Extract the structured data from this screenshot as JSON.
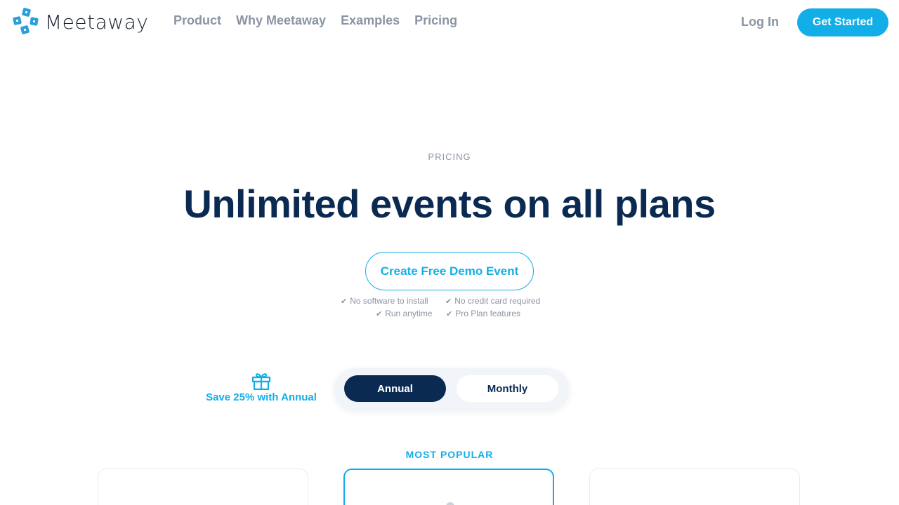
{
  "brand": {
    "name": "Meetaway"
  },
  "nav": {
    "links": [
      "Product",
      "Why Meetaway",
      "Examples",
      "Pricing"
    ],
    "login_label": "Log In",
    "cta_label": "Get Started"
  },
  "hero": {
    "eyebrow": "PRICING",
    "title": "Unlimited events on all plans",
    "demo_button": "Create Free Demo Event",
    "features": [
      "No software to install",
      "No credit card required",
      "Run anytime",
      "Pro Plan features"
    ]
  },
  "billing": {
    "save_text": "Save 25% with Annual",
    "options": [
      "Annual",
      "Monthly"
    ],
    "selected": "Annual"
  },
  "plans": {
    "popular_label": "MOST POPULAR"
  },
  "colors": {
    "accent": "#12aee8",
    "navy": "#0b2a52",
    "muted": "#8a94a3"
  },
  "icons": [
    "logo-icon",
    "check-icon",
    "gift-icon"
  ]
}
